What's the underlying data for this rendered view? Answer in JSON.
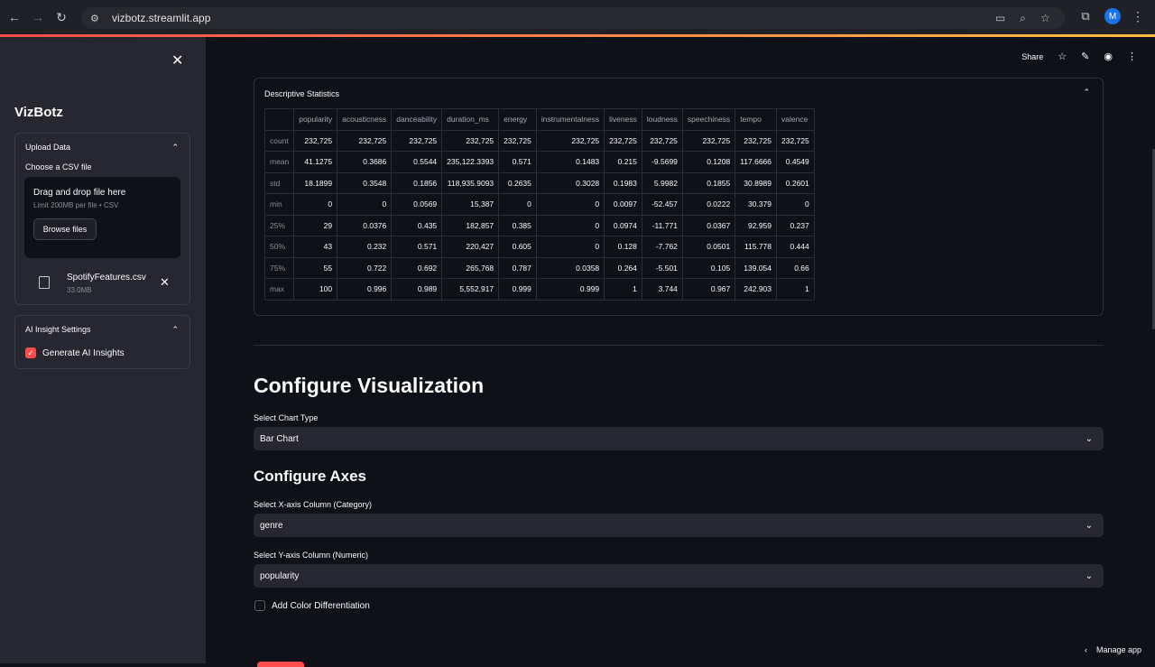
{
  "browser": {
    "url": "vizbotz.streamlit.app",
    "profile_initial": "M"
  },
  "sidebar": {
    "title": "VizBotz",
    "upload": {
      "header": "Upload Data",
      "label": "Choose a CSV file",
      "drop_title": "Drag and drop file here",
      "drop_limit": "Limit 200MB per file • CSV",
      "browse_label": "Browse files",
      "file_name": "SpotifyFeatures.csv",
      "file_size": "33.0MB"
    },
    "ai": {
      "header": "AI Insight Settings",
      "checkbox_label": "Generate AI Insights",
      "checked": true
    }
  },
  "topbar": {
    "share_label": "Share"
  },
  "stats": {
    "title": "Descriptive Statistics",
    "columns": [
      "",
      "popularity",
      "acousticness",
      "danceability",
      "duration_ms",
      "energy",
      "instrumentalness",
      "liveness",
      "loudness",
      "speechiness",
      "tempo",
      "valence"
    ],
    "rows": [
      [
        "count",
        "232,725",
        "232,725",
        "232,725",
        "232,725",
        "232,725",
        "232,725",
        "232,725",
        "232,725",
        "232,725",
        "232,725",
        "232,725"
      ],
      [
        "mean",
        "41.1275",
        "0.3686",
        "0.5544",
        "235,122.3393",
        "0.571",
        "0.1483",
        "0.215",
        "-9.5699",
        "0.1208",
        "117.6666",
        "0.4549"
      ],
      [
        "std",
        "18.1899",
        "0.3548",
        "0.1856",
        "118,935.9093",
        "0.2635",
        "0.3028",
        "0.1983",
        "5.9982",
        "0.1855",
        "30.8989",
        "0.2601"
      ],
      [
        "min",
        "0",
        "0",
        "0.0569",
        "15,387",
        "0",
        "0",
        "0.0097",
        "-52.457",
        "0.0222",
        "30.379",
        "0"
      ],
      [
        "25%",
        "29",
        "0.0376",
        "0.435",
        "182,857",
        "0.385",
        "0",
        "0.0974",
        "-11.771",
        "0.0367",
        "92.959",
        "0.237"
      ],
      [
        "50%",
        "43",
        "0.232",
        "0.571",
        "220,427",
        "0.605",
        "0",
        "0.128",
        "-7.762",
        "0.0501",
        "115.778",
        "0.444"
      ],
      [
        "75%",
        "55",
        "0.722",
        "0.692",
        "265,768",
        "0.787",
        "0.0358",
        "0.264",
        "-5.501",
        "0.105",
        "139.054",
        "0.66"
      ],
      [
        "max",
        "100",
        "0.996",
        "0.989",
        "5,552,917",
        "0.999",
        "0.999",
        "1",
        "3.744",
        "0.967",
        "242.903",
        "1"
      ]
    ]
  },
  "config": {
    "heading": "Configure Visualization",
    "chart_type_label": "Select Chart Type",
    "chart_type_value": "Bar Chart",
    "axes_heading": "Configure Axes",
    "x_label": "Select X-axis Column (Category)",
    "x_value": "genre",
    "y_label": "Select Y-axis Column (Numeric)",
    "y_value": "popularity",
    "color_diff_label": "Add Color Differentiation"
  },
  "footer": {
    "manage_label": "Manage app"
  },
  "colors": {
    "accent": "#ff4b4b",
    "background": "#0e1117",
    "sidebar": "#262730"
  }
}
